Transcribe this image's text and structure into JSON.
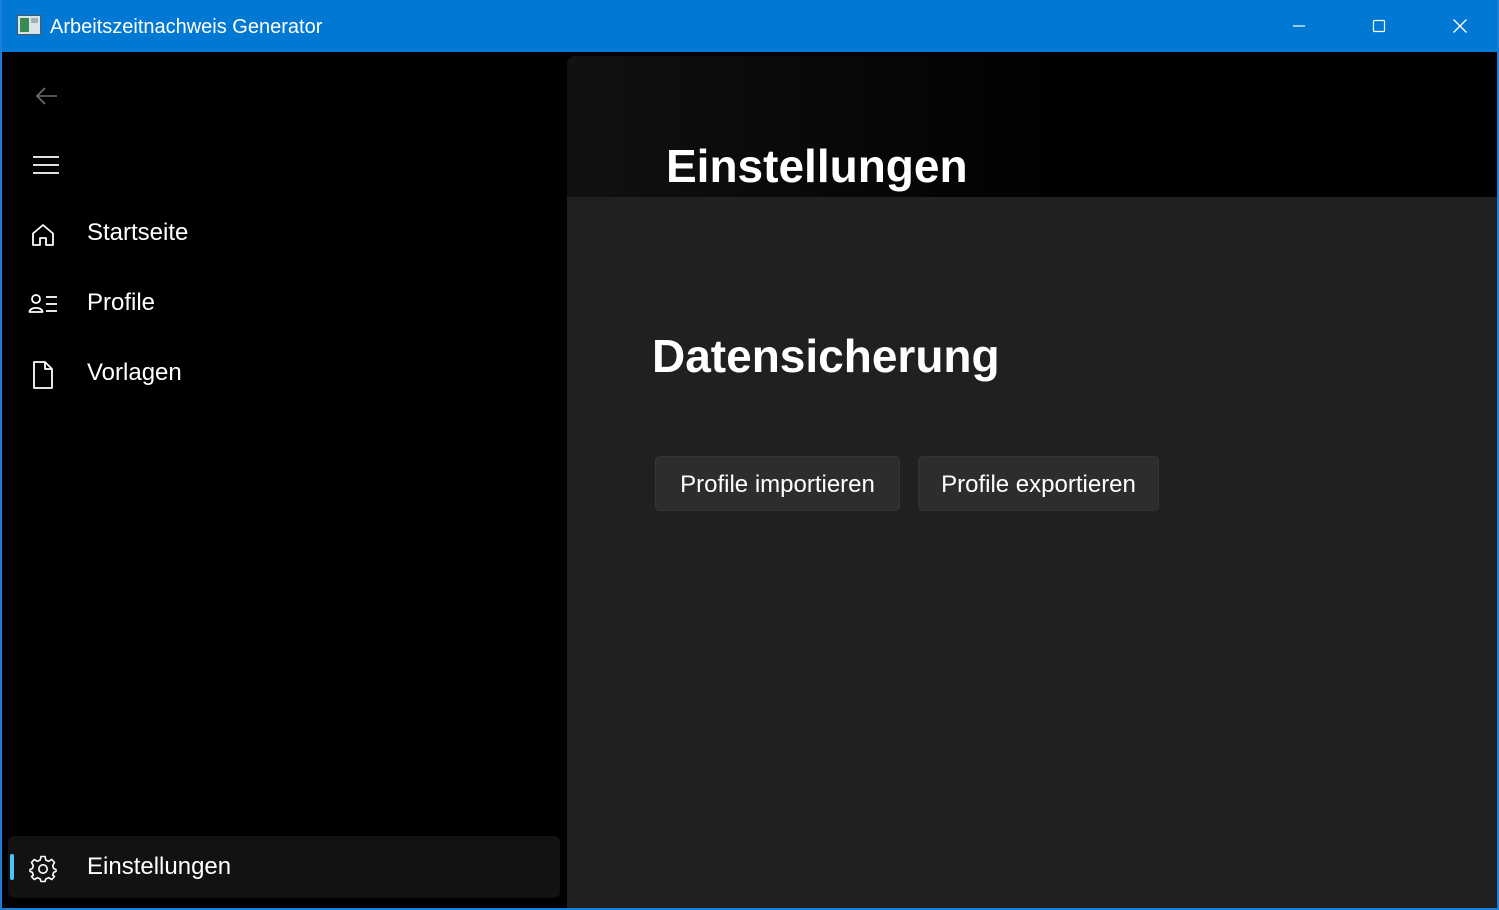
{
  "window": {
    "title": "Arbeitszeitnachweis Generator",
    "accent_color": "#0078d4"
  },
  "titlebar": {
    "icons": [
      "app-icon",
      "minimize-icon",
      "maximize-icon",
      "close-icon"
    ]
  },
  "nav": {
    "back_icon": "back-arrow-icon",
    "menu_icon": "hamburger-menu-icon",
    "items": [
      {
        "label": "Startseite",
        "icon": "home-icon"
      },
      {
        "label": "Profile",
        "icon": "profile-list-icon"
      },
      {
        "label": "Vorlagen",
        "icon": "document-icon"
      }
    ],
    "footer_item": {
      "label": "Einstellungen",
      "icon": "gear-icon",
      "selected": true
    },
    "selection_color": "#4cc2ff"
  },
  "page": {
    "title": "Einstellungen"
  },
  "backup": {
    "title": "Datensicherung",
    "import_label": "Profile importieren",
    "export_label": "Profile exportieren"
  }
}
